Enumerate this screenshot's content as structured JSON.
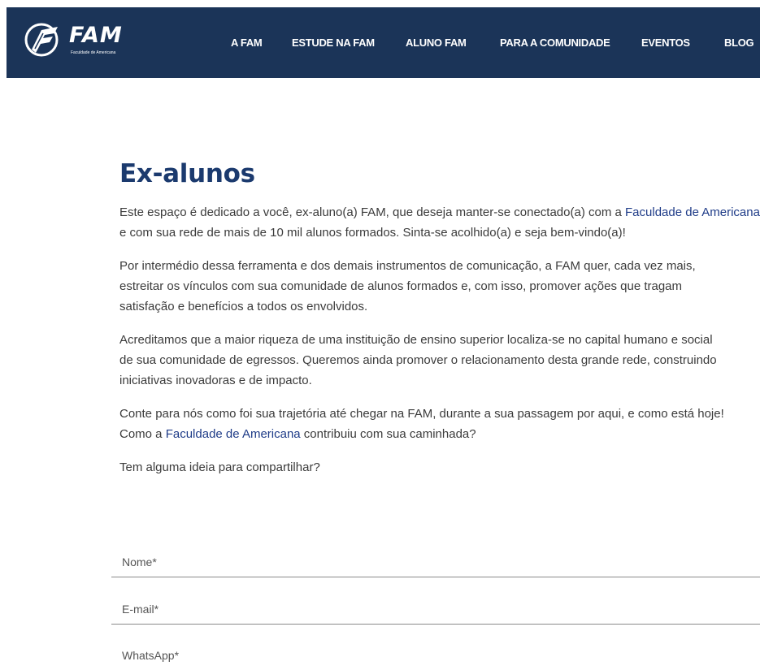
{
  "header": {
    "logo_text": "FAM",
    "logo_subtitle": "Faculdade de Americana",
    "nav": [
      {
        "label": "A FAM"
      },
      {
        "label": "ESTUDE NA FAM"
      },
      {
        "label": "ALUNO FAM"
      },
      {
        "label": "PARA A COMUNIDADE"
      },
      {
        "label": "EVENTOS"
      },
      {
        "label": "BLOG"
      }
    ]
  },
  "main": {
    "title": "Ex-alunos",
    "paragraphs": {
      "p1": {
        "before_link": "Este espaço é dedicado a você, ex-aluno(a) FAM, que deseja manter-se conectado(a) com a ",
        "link": "Faculdade de Americana",
        "after_link": " e com sua rede de mais de 10 mil alunos formados. Sinta-se acolhido(a) e seja bem-vindo(a)!"
      },
      "p2": {
        "line1": "Por intermédio dessa ferramenta e dos demais instrumentos de comunicação, a FAM quer, cada vez mais,",
        "line2": "estreitar os vínculos com sua comunidade de alunos formados e, com isso, promover ações que tragam",
        "line3": "satisfação e benefícios a todos os envolvidos."
      },
      "p3": {
        "line1": "Acreditamos que a maior riqueza de uma instituição de ensino superior localiza-se no capital humano e social",
        "line2": "de sua comunidade de egressos. Queremos ainda promover o relacionamento desta grande rede, construindo",
        "line3": "iniciativas inovadoras e de impacto."
      },
      "p4": {
        "line1": "Conte para nós como foi sua trajetória até chegar na FAM, durante a sua passagem por aqui, e como está hoje!",
        "line2_before": "Como a ",
        "line2_link": "Faculdade de Americana",
        "line2_after": " contribuiu com sua caminhada?"
      },
      "p5": "Tem alguma ideia para compartilhar?"
    },
    "form": {
      "name_placeholder": "Nome*",
      "email_placeholder": "E-mail*",
      "whatsapp_placeholder": "WhatsApp*"
    }
  }
}
